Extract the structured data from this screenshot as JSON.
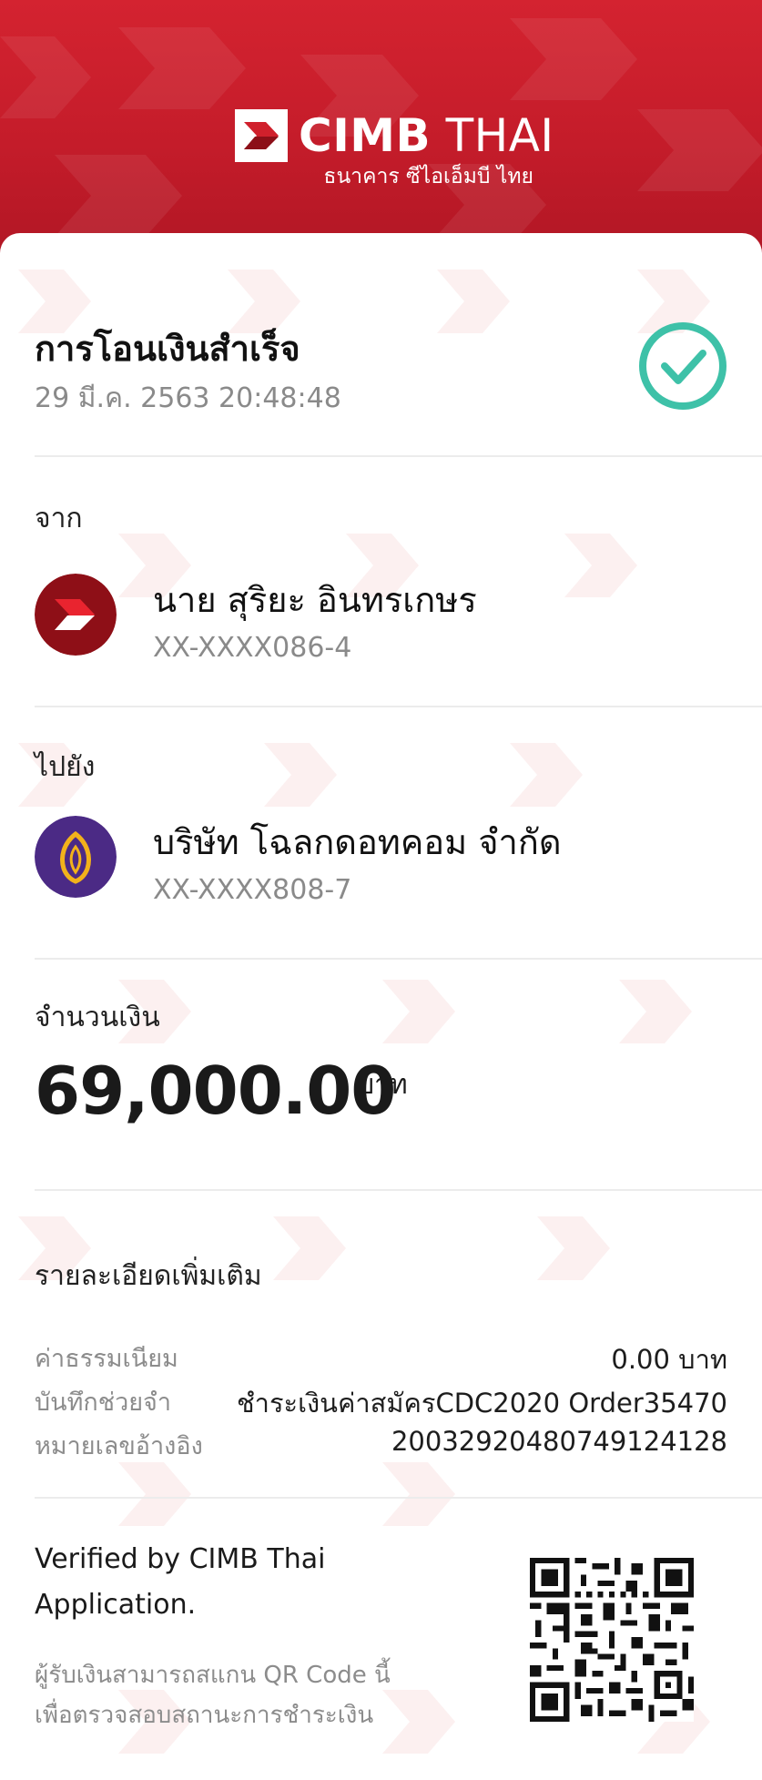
{
  "header": {
    "brand_primary": "CIMB",
    "brand_secondary": "THAI",
    "brand_thai": "ธนาคาร ซีไอเอ็มบี ไทย",
    "color": "#c91f2c"
  },
  "receipt": {
    "title": "การโอนเงินสำเร็จ",
    "datetime": "29 มี.ค. 2563 20:48:48",
    "status_icon": "check-circle-icon",
    "status_color": "#3ec1a8"
  },
  "from": {
    "label": "จาก",
    "name": "นาย สุริยะ อินทรเกษร",
    "account": "XX-XXXX086-4",
    "bank_icon": "cimb-logo-icon"
  },
  "to": {
    "label": "ไปยัง",
    "name": "บริษัท โฉลกดอทคอม จำกัด",
    "account": "XX-XXXX808-7",
    "bank_icon": "scb-logo-icon"
  },
  "amount": {
    "label": "จำนวนเงิน",
    "value": "69,000.00",
    "unit": "บาท"
  },
  "details": {
    "title": "รายละเอียดเพิ่มเติม",
    "rows": [
      {
        "label": "ค่าธรรมเนียม",
        "value": "0.00 บาท"
      },
      {
        "label": "บันทึกช่วยจำ",
        "value": "ชำระเงินค่าสมัครCDC2020 Order35470"
      },
      {
        "label": "หมายเลขอ้างอิง",
        "value": "200329204807491241​28"
      }
    ]
  },
  "verification": {
    "text": "Verified by CIMB Thai Application.",
    "qr_note": "ผู้รับเงินสามารถสแกน QR Code นี้ เพื่อตรวจสอบสถานะการชำระเงิน",
    "qr_icon": "qr-code-icon"
  }
}
